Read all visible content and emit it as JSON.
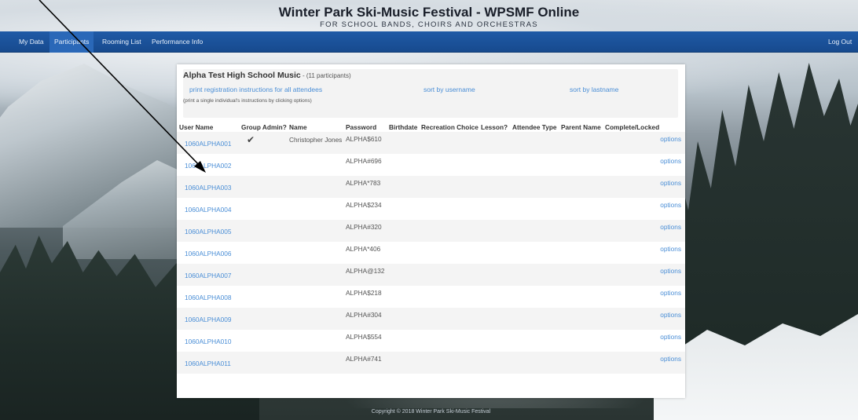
{
  "header": {
    "title": "Winter Park Ski-Music Festival - WPSMF Online",
    "subtitle": "FOR SCHOOL BANDS, CHOIRS AND ORCHESTRAS"
  },
  "nav": {
    "items": [
      {
        "label": "My Data"
      },
      {
        "label": "Participants"
      },
      {
        "label": "Rooming List"
      },
      {
        "label": "Performance Info"
      }
    ],
    "logout": "Log Out"
  },
  "group": {
    "name": "Alpha Test High School Music",
    "count": " - (11 participants)",
    "print_link": "print registration instructions for all attendees",
    "sort_username": "sort by username",
    "sort_lastname": "sort by lastname",
    "note": "(print a single individual's instructions by clicking options)"
  },
  "table": {
    "columns": [
      "User Name",
      "Group Admin?",
      "Name",
      "Password",
      "Birthdate",
      "Recreation Choice",
      "Lesson?",
      "Attendee Type",
      "Parent Name",
      "Complete/Locked"
    ],
    "rows": [
      {
        "username": "1060ALPHA001",
        "admin": "✔",
        "name": "Christopher Jones",
        "password": "ALPHA$610",
        "options": "options"
      },
      {
        "username": "1060ALPHA002",
        "admin": "",
        "name": "",
        "password": "ALPHA#696",
        "options": "options"
      },
      {
        "username": "1060ALPHA003",
        "admin": "",
        "name": "",
        "password": "ALPHA*783",
        "options": "options"
      },
      {
        "username": "1060ALPHA004",
        "admin": "",
        "name": "",
        "password": "ALPHA$234",
        "options": "options"
      },
      {
        "username": "1060ALPHA005",
        "admin": "",
        "name": "",
        "password": "ALPHA#320",
        "options": "options"
      },
      {
        "username": "1060ALPHA006",
        "admin": "",
        "name": "",
        "password": "ALPHA*406",
        "options": "options"
      },
      {
        "username": "1060ALPHA007",
        "admin": "",
        "name": "",
        "password": "ALPHA@132",
        "options": "options"
      },
      {
        "username": "1060ALPHA008",
        "admin": "",
        "name": "",
        "password": "ALPHA$218",
        "options": "options"
      },
      {
        "username": "1060ALPHA009",
        "admin": "",
        "name": "",
        "password": "ALPHA#304",
        "options": "options"
      },
      {
        "username": "1060ALPHA010",
        "admin": "",
        "name": "",
        "password": "ALPHA$554",
        "options": "options"
      },
      {
        "username": "1060ALPHA011",
        "admin": "",
        "name": "",
        "password": "ALPHA#741",
        "options": "options"
      }
    ]
  },
  "footer": {
    "copyright": "Copyright © 2018 Winter Park Ski-Music Festival"
  },
  "colors": {
    "navbar": "#1f5aa6",
    "link": "#4a8ed6",
    "annotation": "#000000"
  }
}
